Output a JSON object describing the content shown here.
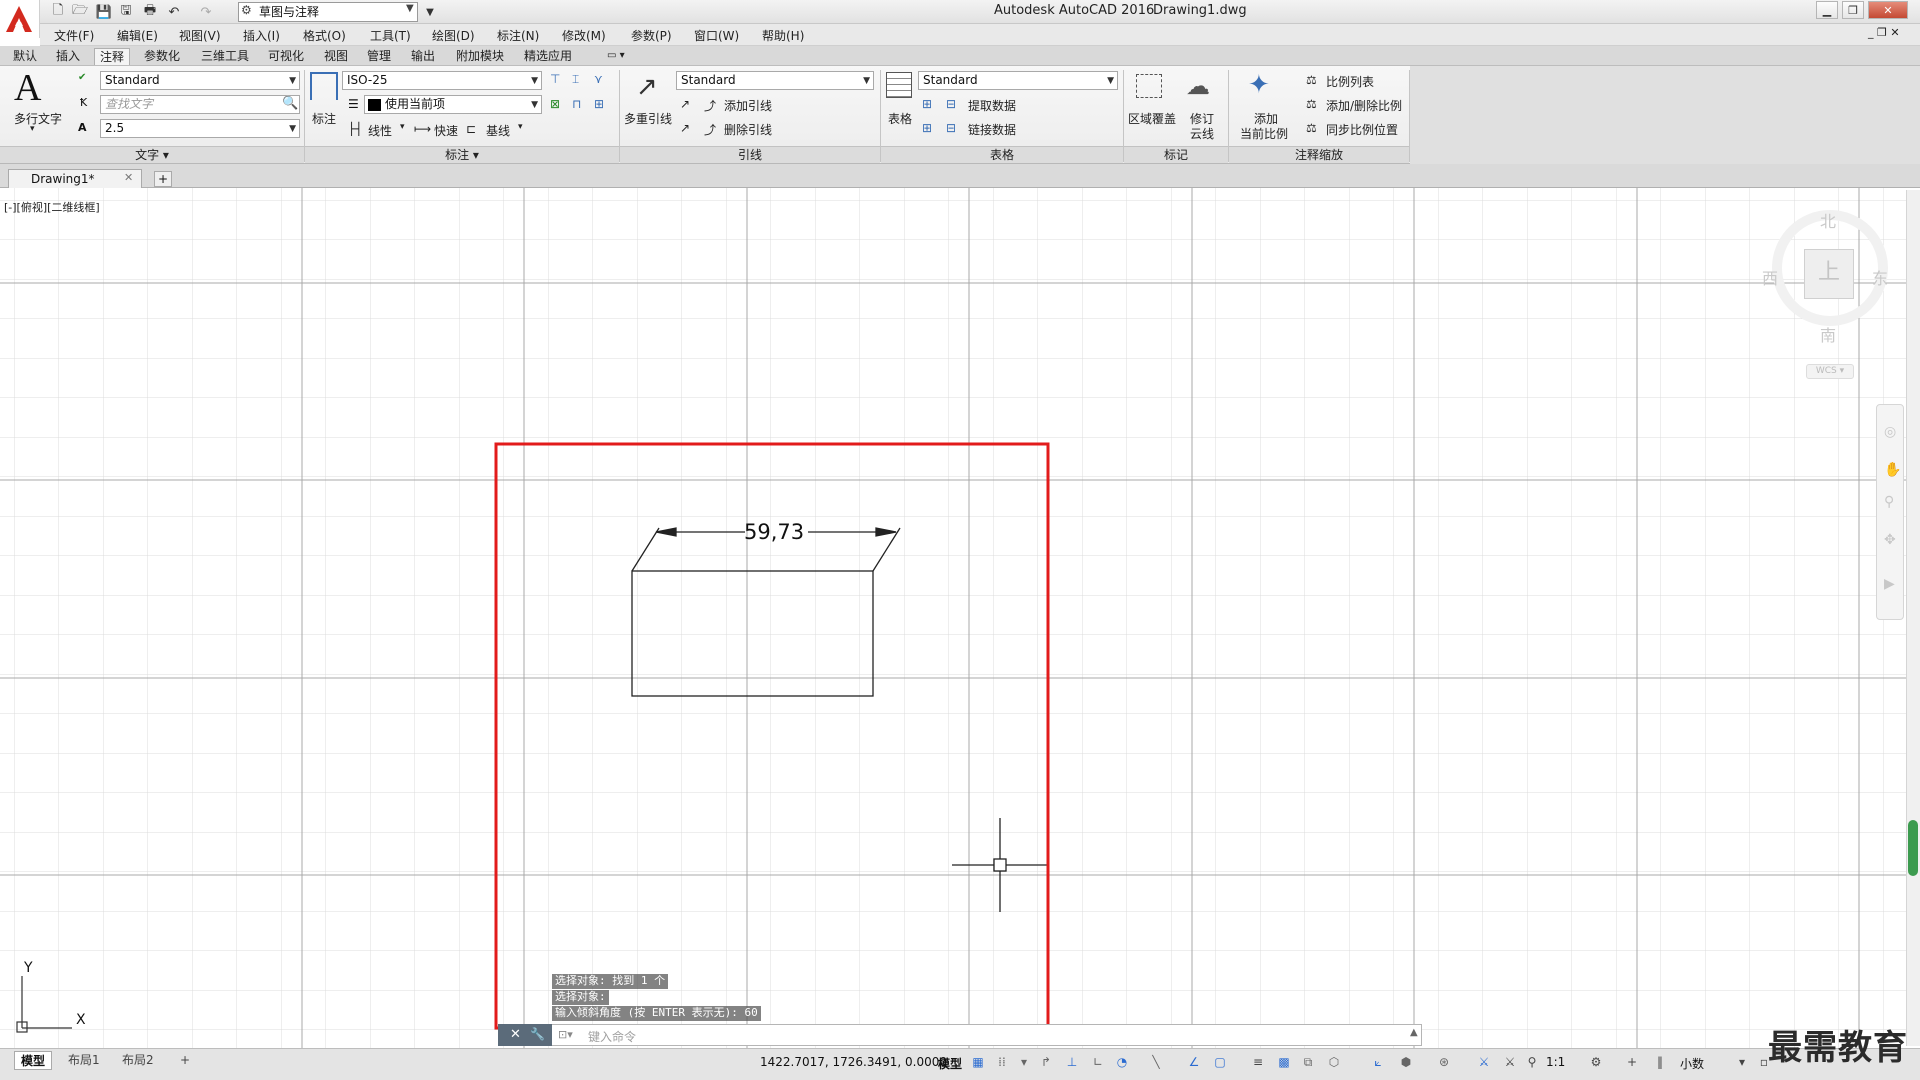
{
  "app": {
    "title": "Autodesk AutoCAD 2016",
    "filename": "Drawing1.dwg",
    "workspace": "草图与注释",
    "accent_red": "#d32a1f"
  },
  "menubar": [
    "文件(F)",
    "编辑(E)",
    "视图(V)",
    "插入(I)",
    "格式(O)",
    "工具(T)",
    "绘图(D)",
    "标注(N)",
    "修改(M)",
    "参数(P)",
    "窗口(W)",
    "帮助(H)"
  ],
  "ribbon_tabs": [
    "默认",
    "插入",
    "注释",
    "参数化",
    "三维工具",
    "可视化",
    "视图",
    "管理",
    "输出",
    "附加模块",
    "精选应用"
  ],
  "ribbon": {
    "text_panel": {
      "title": "文字",
      "mtext_label": "多行文字",
      "style_value": "Standard",
      "find_placeholder": "查找文字",
      "height_value": "2.5"
    },
    "dim_panel": {
      "title": "标注",
      "dim_label": "标注",
      "style_value": "ISO-25",
      "layer_value": "使用当前项",
      "linear_label": "线性",
      "quick_label": "快速",
      "baseline_label": "基线"
    },
    "leader_panel": {
      "title": "引线",
      "mleader_label": "多重引线",
      "style_value": "Standard",
      "add_leader": "添加引线",
      "remove_leader": "删除引线"
    },
    "table_panel": {
      "title": "表格",
      "table_label": "表格",
      "style_value": "Standard",
      "extract_data": "提取数据",
      "link_data": "链接数据"
    },
    "markup_panel": {
      "title": "标记",
      "wipeout_label": "区域覆盖",
      "revcloud_label_1": "修订",
      "revcloud_label_2": "云线"
    },
    "scale_panel": {
      "title": "注释缩放",
      "add_current_1": "添加",
      "add_current_2": "当前比例",
      "scale_list": "比例列表",
      "add_remove_scale": "添加/删除比例",
      "sync_scale": "同步比例位置"
    }
  },
  "doc_tab": {
    "name": "Drawing1*"
  },
  "viewport_label": "[-][俯视][二维线框]",
  "drawing": {
    "dimension_text": "59,73"
  },
  "viewcube": {
    "north": "北",
    "south": "南",
    "east": "东",
    "west": "西",
    "wcs": "WCS"
  },
  "ucs": {
    "x": "X",
    "y": "Y"
  },
  "command": {
    "history": [
      "选择对象: 找到 1 个",
      "选择对象:",
      "输入倾斜角度 (按 ENTER 表示无): 60"
    ],
    "input_placeholder": "键入命令"
  },
  "layout_tabs": [
    "模型",
    "布局1",
    "布局2"
  ],
  "status": {
    "coords": "1422.7017, 1726.3491, 0.0000",
    "model": "模型",
    "scale": "1:1",
    "units": "小数"
  },
  "watermark": "最需教育"
}
